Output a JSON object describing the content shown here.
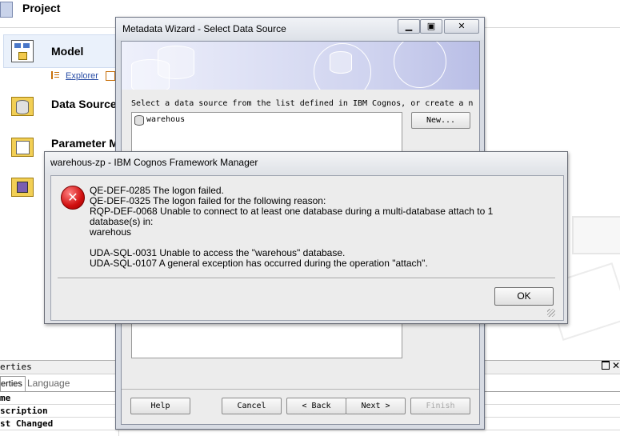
{
  "app": {
    "project_title": "Project",
    "model_label": "Model",
    "explorer_link": "Explorer",
    "data_sources_label": "Data Source",
    "parameter_maps_label": "Parameter M"
  },
  "properties": {
    "header": "erties",
    "tabs": [
      "erties",
      "Language"
    ],
    "rows": [
      "me",
      "scription",
      "st Changed"
    ]
  },
  "wizard": {
    "title": "Metadata Wizard - Select Data Source",
    "instruction": "Select a data source from the list defined in IBM Cognos, or create a n",
    "datasources": [
      "warehous"
    ],
    "new_button": "New...",
    "buttons": {
      "help": "Help",
      "cancel": "Cancel",
      "back": "< Back",
      "next": "Next >",
      "finish": "Finish"
    }
  },
  "error_dialog": {
    "title": "warehous-zp - IBM Cognos Framework Manager",
    "lines": [
      "QE-DEF-0285 The logon failed.",
      "QE-DEF-0325 The logon failed for the following reason:",
      "RQP-DEF-0068 Unable to connect to at least one database during a multi-database attach to 1",
      "database(s) in:",
      "warehous",
      "",
      "UDA-SQL-0031 Unable to access the \"warehous\" database.",
      "UDA-SQL-0107 A general exception has occurred during the operation \"attach\"."
    ],
    "ok_button": "OK"
  }
}
